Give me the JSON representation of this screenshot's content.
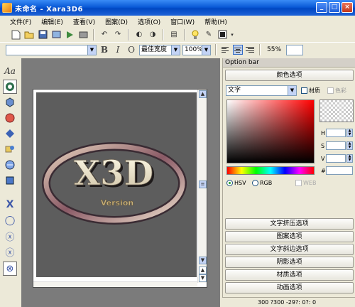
{
  "window": {
    "title": "未命名 - Xara3D6"
  },
  "menu": [
    {
      "label": "文件(F)"
    },
    {
      "label": "编辑(E)"
    },
    {
      "label": "查看(V)"
    },
    {
      "label": "图案(D)"
    },
    {
      "label": "选项(O)"
    },
    {
      "label": "窗口(W)"
    },
    {
      "label": "帮助(H)"
    }
  ],
  "toolbar2": {
    "font_value": "",
    "bold": "B",
    "italic": "I",
    "outline": "O",
    "width_mode": "最佳宽度",
    "zoom": "100%",
    "percent": "55%"
  },
  "canvas": {
    "logo_text": "X3D",
    "sub_text": "Version"
  },
  "option_bar": {
    "title": "Option bar",
    "color_options": "颜色选项",
    "target": "文字",
    "texture_label": "材质",
    "shade_label": "色彩",
    "h_label": "H",
    "s_label": "S",
    "v_label": "V",
    "hash_label": "#",
    "hsv_label": "HSV",
    "rgb_label": "RGB",
    "web_label": "WEB",
    "sections": [
      {
        "label": "文字挤压选项"
      },
      {
        "label": "图案选项"
      },
      {
        "label": "文字斜边选项"
      },
      {
        "label": "阴影选项"
      },
      {
        "label": "材质选项"
      },
      {
        "label": "动画选项"
      }
    ]
  },
  "status": {
    "text": "300 ?300  -29?: 0?: 0"
  }
}
